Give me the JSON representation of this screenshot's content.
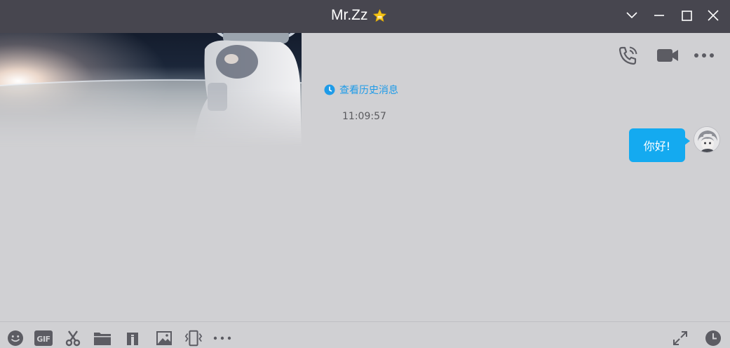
{
  "window": {
    "title": "Mr.Zz",
    "title_badge": "star-badge-icon",
    "controls": [
      "chevron-down-icon",
      "minimize-icon",
      "maximize-icon",
      "close-icon"
    ]
  },
  "header_actions": [
    "voice-call-icon",
    "video-call-icon",
    "more-options-icon"
  ],
  "chat": {
    "history_link": "查看历史消息",
    "timestamp": "11:09:57",
    "messages": [
      {
        "sender": "self",
        "text": "你好!"
      }
    ]
  },
  "toolbar": {
    "gif_label": "GIF",
    "items": [
      "emoji-icon",
      "gif-icon",
      "scissors-icon",
      "folder-icon",
      "music-icon",
      "image-icon",
      "shake-icon",
      "more-icon"
    ],
    "right_items": [
      "expand-icon",
      "history-clock-icon"
    ]
  },
  "colors": {
    "titlebar": "#47464f",
    "background": "#d0d0d3",
    "bubble": "#14aaf0",
    "link": "#1e9be8",
    "star": "#f5c518",
    "icon": "#5c5c63"
  }
}
